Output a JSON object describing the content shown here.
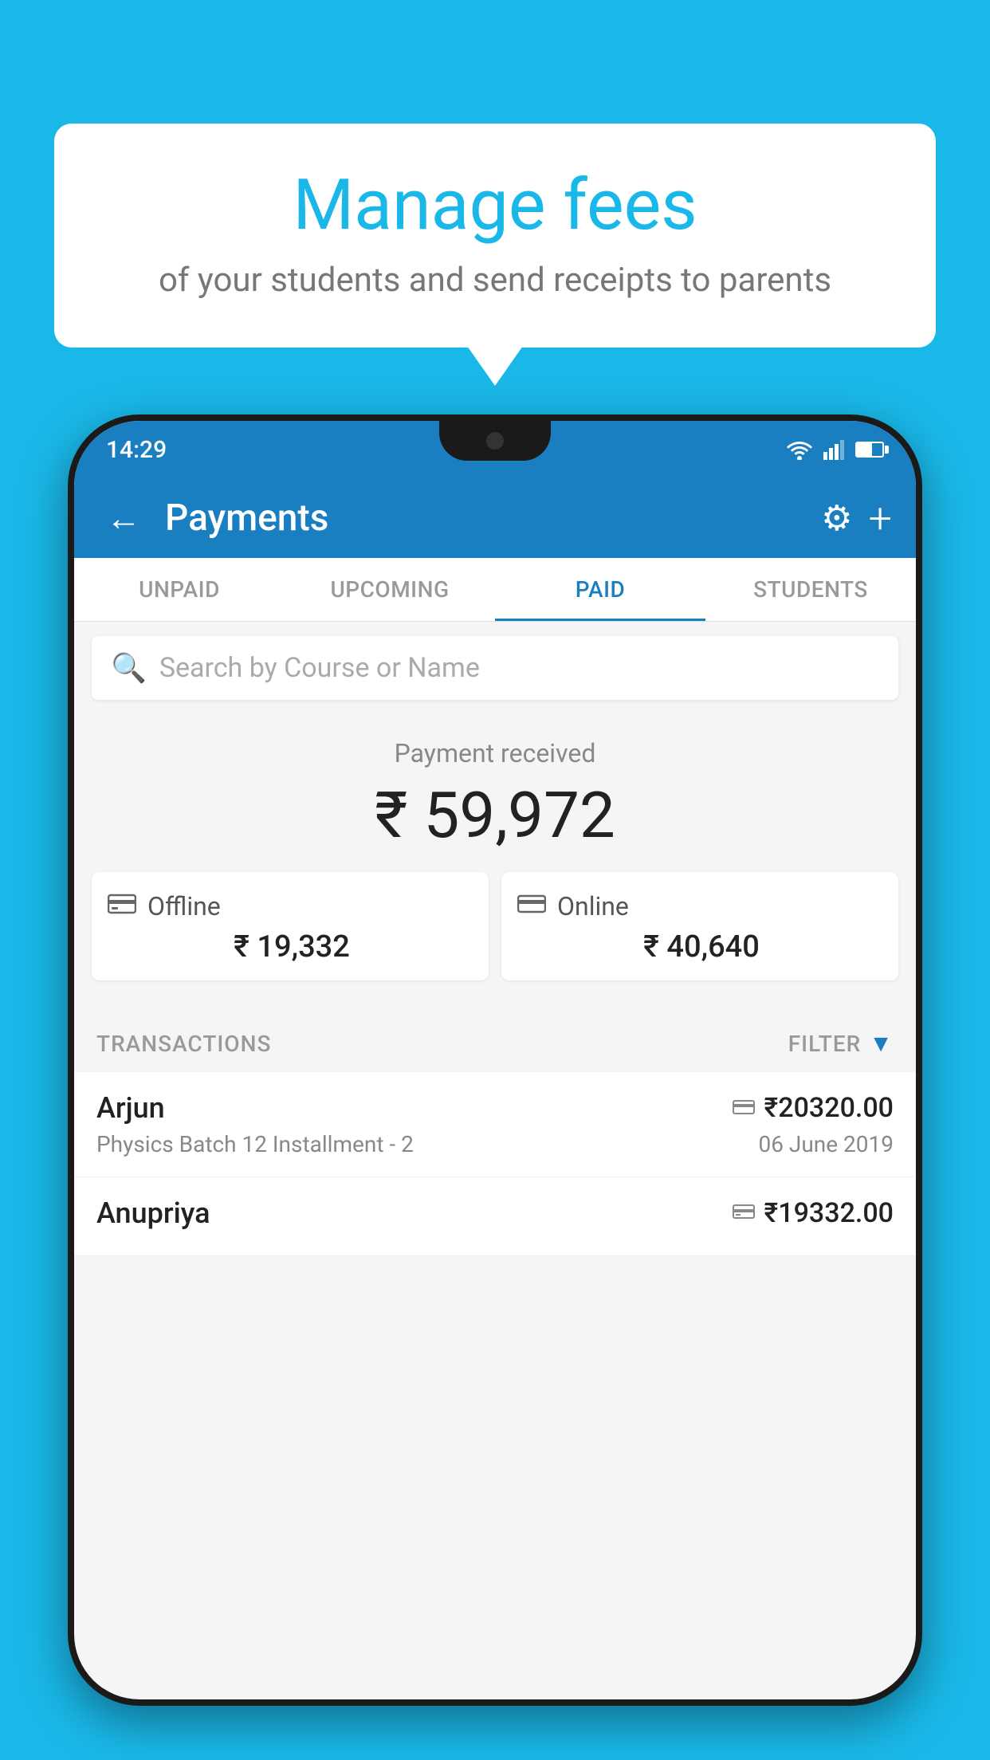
{
  "background_color": "#1ab8e8",
  "speech_bubble": {
    "title": "Manage fees",
    "subtitle": "of your students and send receipts to parents"
  },
  "status_bar": {
    "time": "14:29"
  },
  "app_bar": {
    "title": "Payments",
    "back_label": "←",
    "gear_label": "⚙",
    "plus_label": "+"
  },
  "tabs": [
    {
      "label": "UNPAID",
      "active": false
    },
    {
      "label": "UPCOMING",
      "active": false
    },
    {
      "label": "PAID",
      "active": true
    },
    {
      "label": "STUDENTS",
      "active": false
    }
  ],
  "search": {
    "placeholder": "Search by Course or Name"
  },
  "payment_summary": {
    "label": "Payment received",
    "amount": "₹ 59,972",
    "offline": {
      "label": "Offline",
      "amount": "₹ 19,332"
    },
    "online": {
      "label": "Online",
      "amount": "₹ 40,640"
    }
  },
  "transactions_header": {
    "label": "TRANSACTIONS",
    "filter_label": "FILTER"
  },
  "transactions": [
    {
      "name": "Arjun",
      "amount": "₹20320.00",
      "course": "Physics Batch 12 Installment - 2",
      "date": "06 June 2019",
      "type": "online"
    },
    {
      "name": "Anupriya",
      "amount": "₹19332.00",
      "course": "",
      "date": "",
      "type": "offline"
    }
  ]
}
